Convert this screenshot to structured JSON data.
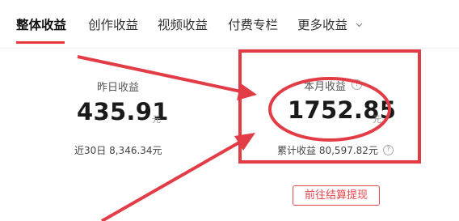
{
  "tabs": [
    {
      "label": "整体收益",
      "active": true
    },
    {
      "label": "创作收益",
      "active": false
    },
    {
      "label": "视频收益",
      "active": false
    },
    {
      "label": "付费专栏",
      "active": false
    },
    {
      "label": "更多收益",
      "active": false,
      "has_dropdown": true
    }
  ],
  "yesterday": {
    "label": "昨日收益",
    "value": "435.91",
    "unit": "元",
    "sub_prefix": "近30日",
    "sub_value": "8,346.34元"
  },
  "month": {
    "label": "本月收益",
    "value": "1752.85",
    "unit": "元",
    "sub_prefix": "累计收益",
    "sub_value": "80,597.82元"
  },
  "settle_button": "前往结算提现",
  "help_icon_glyph": "?",
  "annotation": {
    "color": "#e23c47",
    "shapes": [
      "highlight-box",
      "highlight-circle",
      "arrow-1",
      "arrow-2"
    ]
  },
  "colors": {
    "accent": "#e8383d",
    "text": "#222222",
    "muted": "#999999"
  }
}
